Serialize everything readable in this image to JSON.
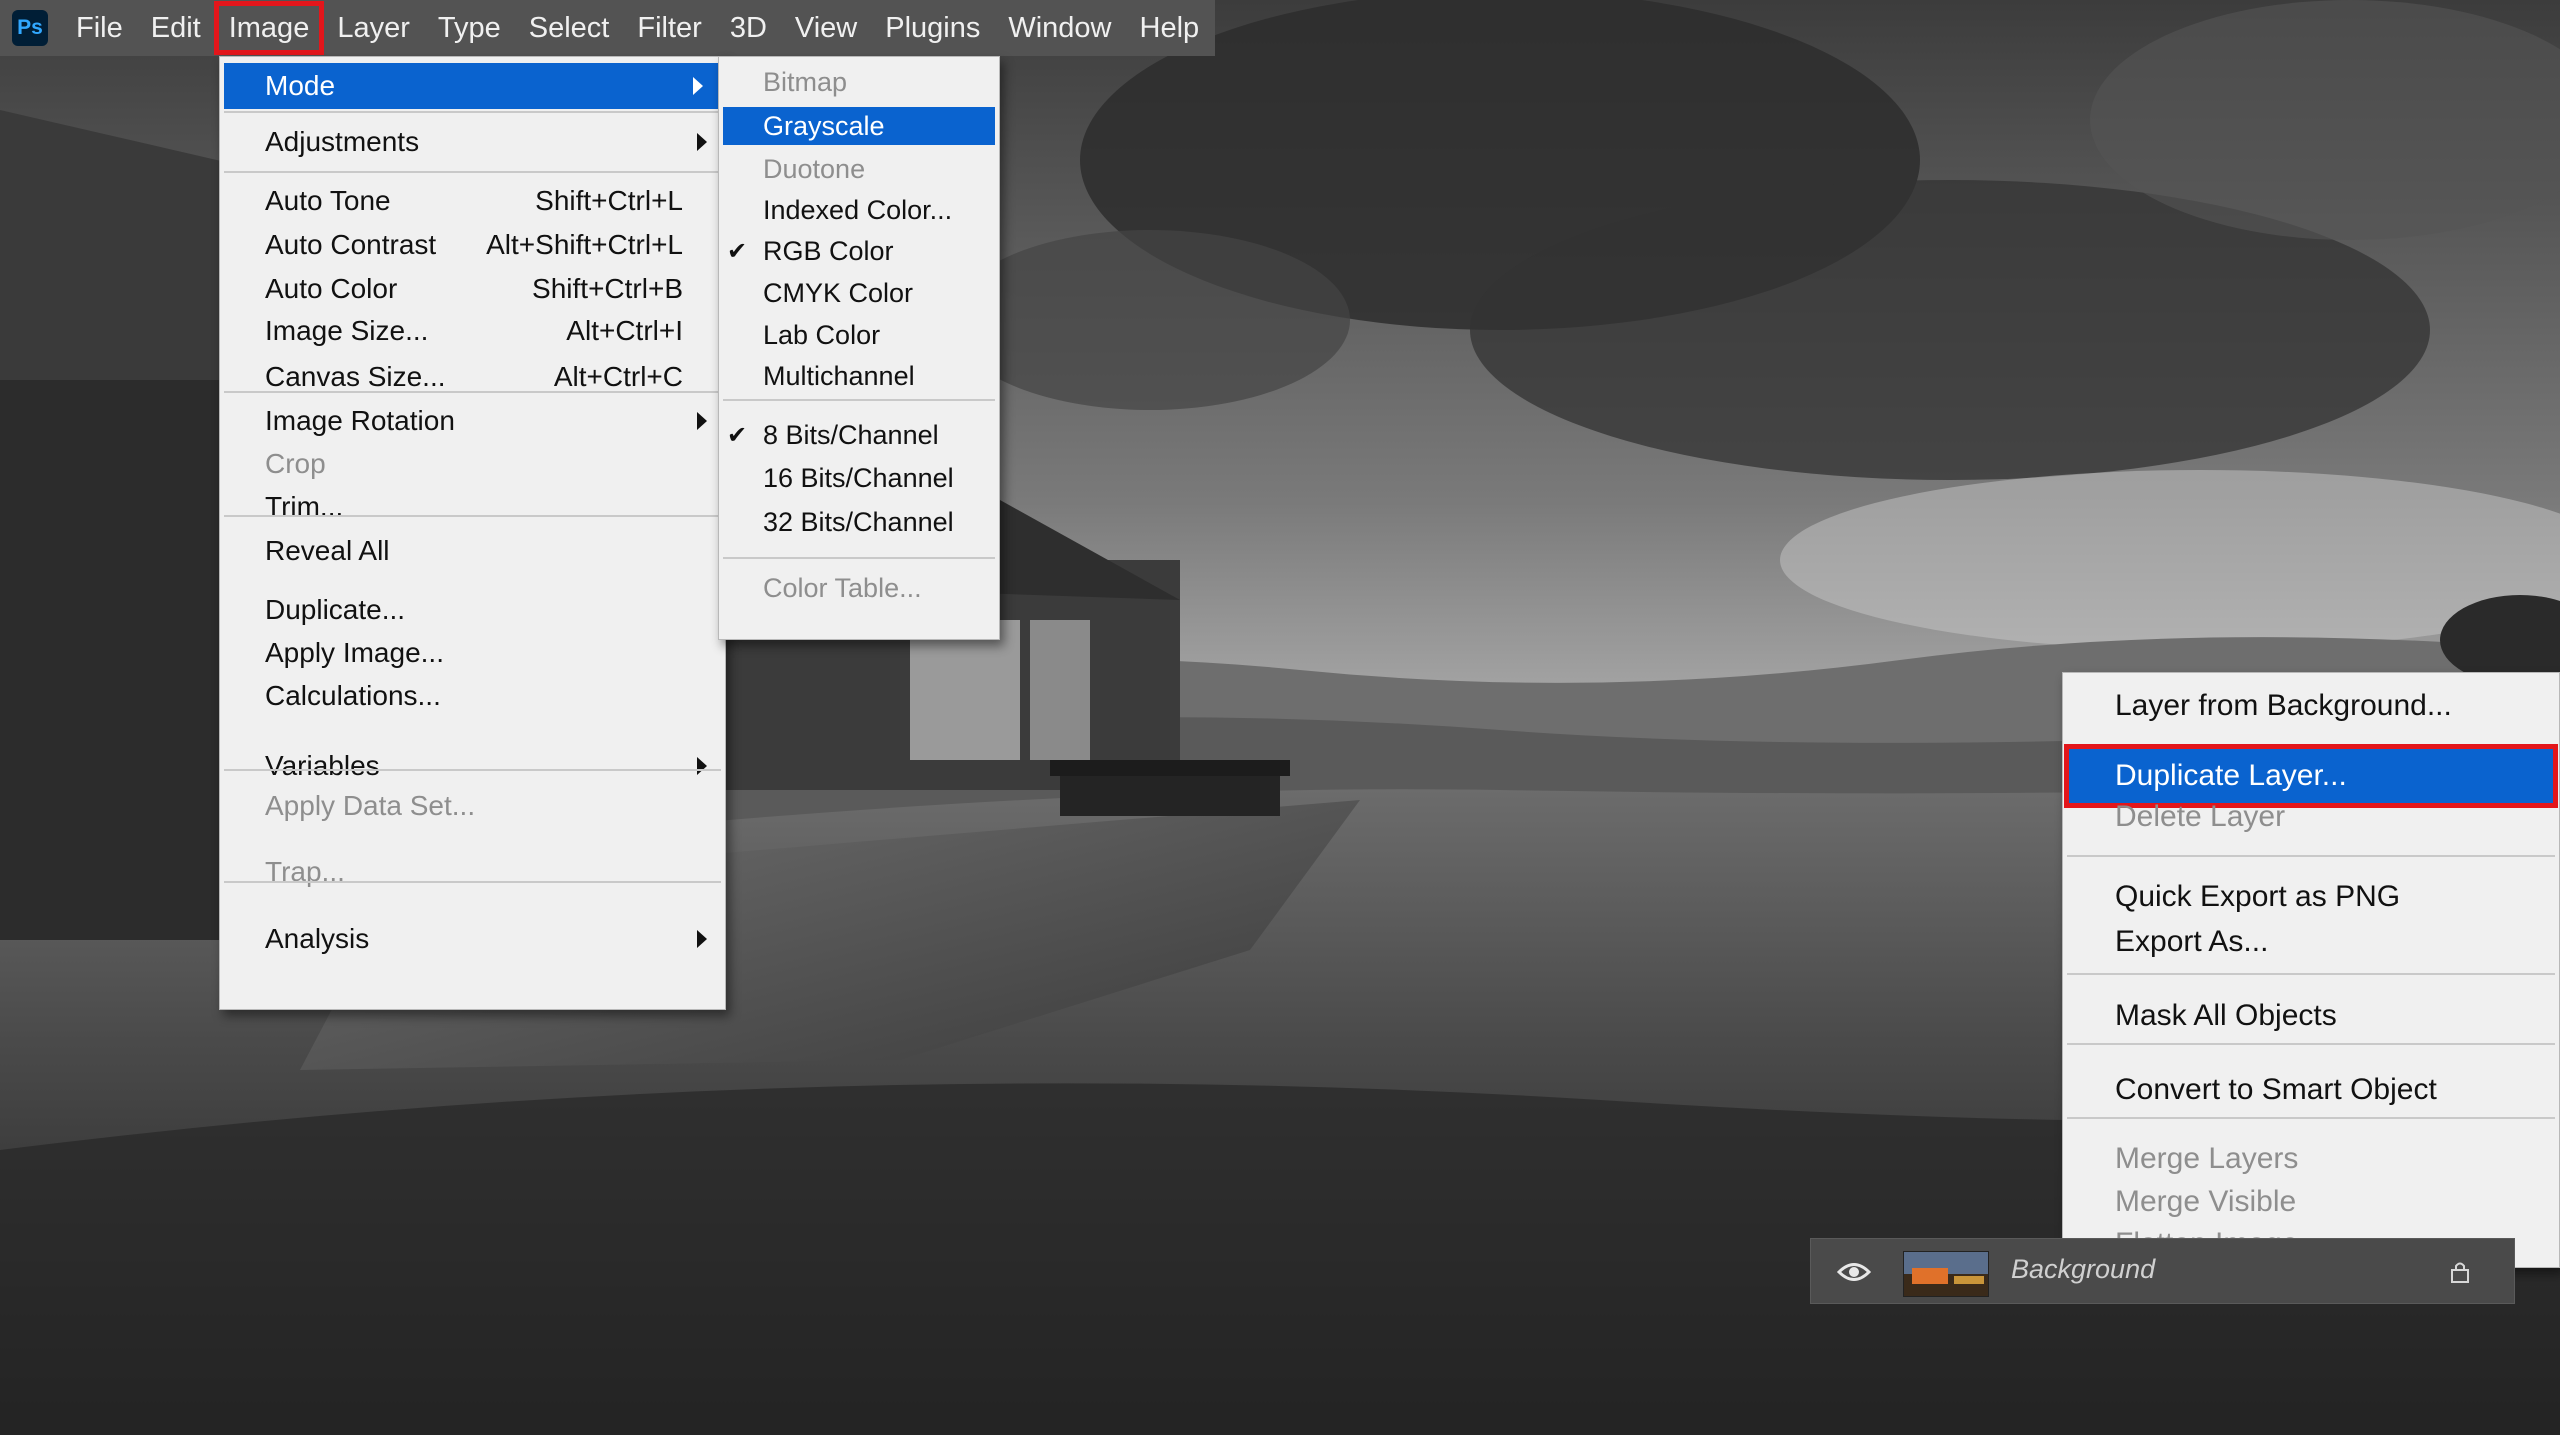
{
  "app": {
    "logo_text": "Ps"
  },
  "menubar": [
    {
      "label": "File"
    },
    {
      "label": "Edit"
    },
    {
      "label": "Image"
    },
    {
      "label": "Layer"
    },
    {
      "label": "Type"
    },
    {
      "label": "Select"
    },
    {
      "label": "Filter"
    },
    {
      "label": "3D"
    },
    {
      "label": "View"
    },
    {
      "label": "Plugins"
    },
    {
      "label": "Window"
    },
    {
      "label": "Help"
    }
  ],
  "image_menu": {
    "items": [
      {
        "label": "Mode",
        "submenu": true,
        "highlighted": true
      },
      {
        "label": "Adjustments",
        "submenu": true
      },
      {
        "label": "Auto Tone",
        "shortcut": "Shift+Ctrl+L"
      },
      {
        "label": "Auto Contrast",
        "shortcut": "Alt+Shift+Ctrl+L"
      },
      {
        "label": "Auto Color",
        "shortcut": "Shift+Ctrl+B"
      },
      {
        "label": "Image Size...",
        "shortcut": "Alt+Ctrl+I"
      },
      {
        "label": "Canvas Size...",
        "shortcut": "Alt+Ctrl+C"
      },
      {
        "label": "Image Rotation",
        "submenu": true
      },
      {
        "label": "Crop",
        "disabled": true
      },
      {
        "label": "Trim..."
      },
      {
        "label": "Reveal All"
      },
      {
        "label": "Duplicate..."
      },
      {
        "label": "Apply Image..."
      },
      {
        "label": "Calculations..."
      },
      {
        "label": "Variables",
        "submenu": true
      },
      {
        "label": "Apply Data Set...",
        "disabled": true
      },
      {
        "label": "Trap...",
        "disabled": true
      },
      {
        "label": "Analysis",
        "submenu": true
      }
    ]
  },
  "mode_submenu": {
    "items": [
      {
        "label": "Bitmap",
        "disabled": true
      },
      {
        "label": "Grayscale",
        "highlighted": true
      },
      {
        "label": "Duotone",
        "disabled": true
      },
      {
        "label": "Indexed Color..."
      },
      {
        "label": "RGB Color",
        "checked": true
      },
      {
        "label": "CMYK Color"
      },
      {
        "label": "Lab Color"
      },
      {
        "label": "Multichannel"
      },
      {
        "label": "8 Bits/Channel",
        "checked": true
      },
      {
        "label": "16 Bits/Channel"
      },
      {
        "label": "32 Bits/Channel"
      },
      {
        "label": "Color Table...",
        "disabled": true
      }
    ]
  },
  "context_menu": {
    "items": [
      {
        "label": "Layer from Background..."
      },
      {
        "label": "Duplicate Layer...",
        "highlighted": true
      },
      {
        "label": "Delete Layer",
        "disabled": true
      },
      {
        "label": "Quick Export as PNG"
      },
      {
        "label": "Export As..."
      },
      {
        "label": "Mask All Objects"
      },
      {
        "label": "Convert to Smart Object"
      },
      {
        "label": "Merge Layers",
        "disabled": true
      },
      {
        "label": "Merge Visible",
        "disabled": true
      },
      {
        "label": "Flatten Image",
        "disabled": true
      }
    ]
  },
  "layers_panel": {
    "layer_name": "Background"
  },
  "colors": {
    "menubar_bg": "#535353",
    "menu_bg": "#f0f0f0",
    "highlight": "#0a63cf",
    "annotation_outline": "#e3161b"
  }
}
